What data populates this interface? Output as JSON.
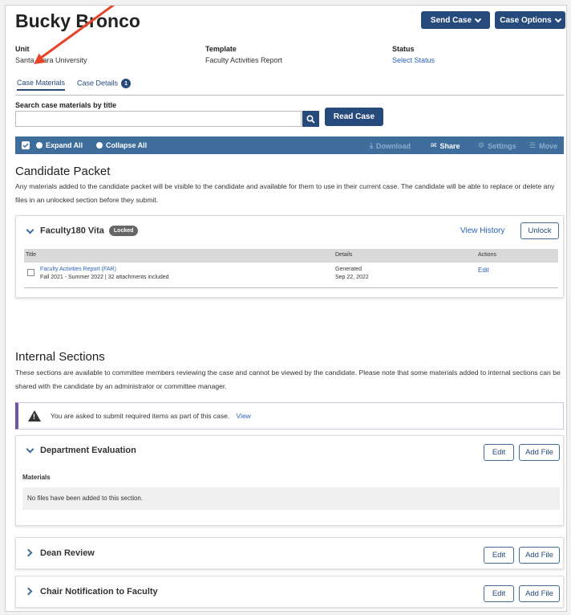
{
  "header": {
    "title": "Bucky Bronco",
    "send_case": "Send Case",
    "case_options": "Case Options"
  },
  "meta": {
    "unit_label": "Unit",
    "unit_value": "Santa Clara University",
    "template_label": "Template",
    "template_value": "Faculty Activities Report",
    "status_label": "Status",
    "status_value": "Select Status"
  },
  "tabs": [
    {
      "label": "Case Materials",
      "active": true
    },
    {
      "label": "Case Details",
      "badge": "1"
    }
  ],
  "search": {
    "label": "Search case materials by title",
    "value": "",
    "read_case": "Read Case"
  },
  "toolbar": {
    "expand_all": "Expand All",
    "collapse_all": "Collapse All",
    "download": "Download",
    "share": "Share",
    "settings": "Settings",
    "move": "Move"
  },
  "candidate_packet": {
    "title": "Candidate Packet",
    "description": "Any materials added to the candidate packet will be visible to the candidate and available for them to use in their current case. The candidate will be able to replace or delete any files in an unlocked section before they submit.",
    "card": {
      "title": "Faculty180 Vita",
      "badge": "Locked",
      "view_history": "View History",
      "unlock": "Unlock",
      "columns": [
        "Title",
        "Details",
        "Actions"
      ],
      "rows": [
        {
          "title": "Faculty Activities Report (FAR)",
          "subtitle": "Fall 2021 - Summer 2022 | 32 attachments included",
          "detail_1": "Generated",
          "detail_2": "Sep 22, 2022",
          "action": "Edit"
        }
      ]
    }
  },
  "internal_sections": {
    "title": "Internal Sections",
    "description": "These sections are available to committee members reviewing the case and cannot be viewed by the candidate. Please note that some materials added to internal sections can be shared with the candidate by an administrator or committee manager.",
    "alert_text": "You are asked to submit required items as part of this case.",
    "alert_link": "View",
    "sections": [
      {
        "title": "Department Evaluation",
        "materials_label": "Materials",
        "empty_text": "No files have been added to this section.",
        "edit": "Edit",
        "add_file": "Add File"
      },
      {
        "title": "Dean Review",
        "edit": "Edit",
        "add_file": "Add File"
      },
      {
        "title": "Chair Notification to Faculty",
        "edit": "Edit",
        "add_file": "Add File"
      }
    ]
  },
  "colors": {
    "primary": "#264a7c",
    "toolbar": "#3f6e9c",
    "link": "#2a62b8",
    "annotation_arrow": "#e8442a",
    "alert_accent": "#7354a8"
  }
}
